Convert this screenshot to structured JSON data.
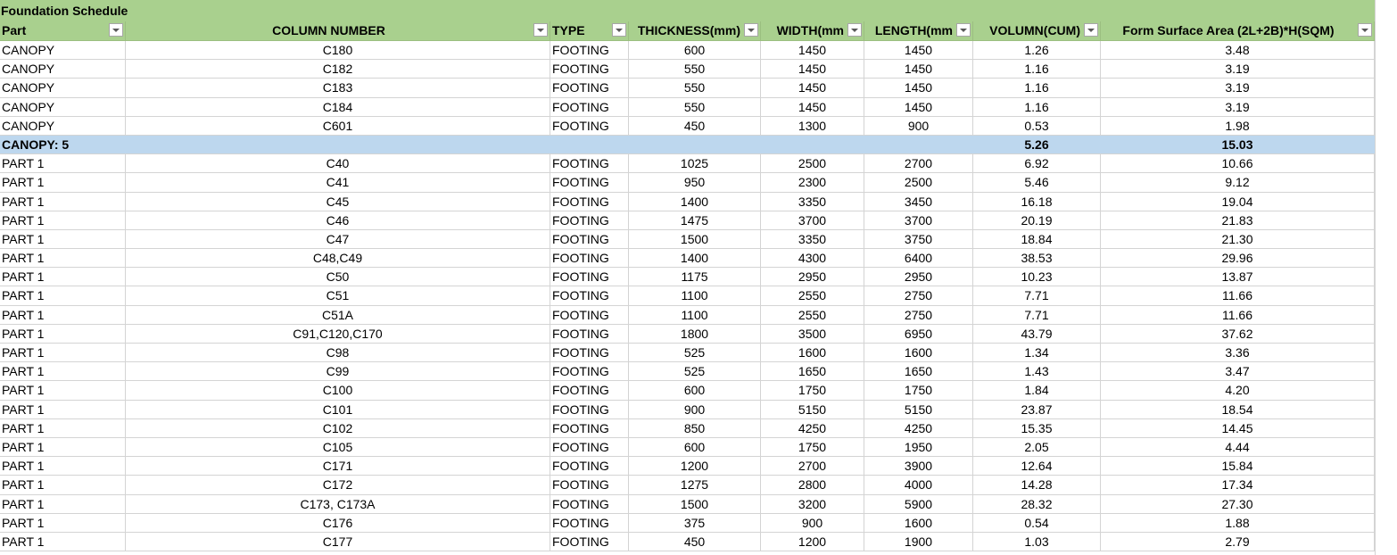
{
  "title": "Foundation Schedule",
  "headers": {
    "part": "Part",
    "column": "COLUMN NUMBER",
    "type": "TYPE",
    "thickness": "THICKNESS(mm)",
    "width": "WIDTH(mm",
    "length": "LENGTH(mm",
    "volume": "VOLUMN(CUM)",
    "form": "Form Surface Area (2L+2B)*H(SQM)"
  },
  "rows": [
    {
      "part": "CANOPY",
      "column": "C180",
      "type": "FOOTING",
      "thickness": "600",
      "width": "1450",
      "length": "1450",
      "volume": "1.26",
      "form": "3.48"
    },
    {
      "part": "CANOPY",
      "column": "C182",
      "type": "FOOTING",
      "thickness": "550",
      "width": "1450",
      "length": "1450",
      "volume": "1.16",
      "form": "3.19"
    },
    {
      "part": "CANOPY",
      "column": "C183",
      "type": "FOOTING",
      "thickness": "550",
      "width": "1450",
      "length": "1450",
      "volume": "1.16",
      "form": "3.19"
    },
    {
      "part": "CANOPY",
      "column": "C184",
      "type": "FOOTING",
      "thickness": "550",
      "width": "1450",
      "length": "1450",
      "volume": "1.16",
      "form": "3.19"
    },
    {
      "part": "CANOPY",
      "column": "C601",
      "type": "FOOTING",
      "thickness": "450",
      "width": "1300",
      "length": "900",
      "volume": "0.53",
      "form": "1.98"
    },
    {
      "part": "CANOPY: 5",
      "column": "",
      "type": "",
      "thickness": "",
      "width": "",
      "length": "",
      "volume": "5.26",
      "form": "15.03",
      "subtotal": true
    },
    {
      "part": "PART 1",
      "column": "C40",
      "type": "FOOTING",
      "thickness": "1025",
      "width": "2500",
      "length": "2700",
      "volume": "6.92",
      "form": "10.66"
    },
    {
      "part": "PART 1",
      "column": "C41",
      "type": "FOOTING",
      "thickness": "950",
      "width": "2300",
      "length": "2500",
      "volume": "5.46",
      "form": "9.12"
    },
    {
      "part": "PART 1",
      "column": "C45",
      "type": "FOOTING",
      "thickness": "1400",
      "width": "3350",
      "length": "3450",
      "volume": "16.18",
      "form": "19.04"
    },
    {
      "part": "PART 1",
      "column": "C46",
      "type": "FOOTING",
      "thickness": "1475",
      "width": "3700",
      "length": "3700",
      "volume": "20.19",
      "form": "21.83"
    },
    {
      "part": "PART 1",
      "column": "C47",
      "type": "FOOTING",
      "thickness": "1500",
      "width": "3350",
      "length": "3750",
      "volume": "18.84",
      "form": "21.30"
    },
    {
      "part": "PART 1",
      "column": "C48,C49",
      "type": "FOOTING",
      "thickness": "1400",
      "width": "4300",
      "length": "6400",
      "volume": "38.53",
      "form": "29.96"
    },
    {
      "part": "PART 1",
      "column": "C50",
      "type": "FOOTING",
      "thickness": "1175",
      "width": "2950",
      "length": "2950",
      "volume": "10.23",
      "form": "13.87"
    },
    {
      "part": "PART 1",
      "column": "C51",
      "type": "FOOTING",
      "thickness": "1100",
      "width": "2550",
      "length": "2750",
      "volume": "7.71",
      "form": "11.66"
    },
    {
      "part": "PART 1",
      "column": "C51A",
      "type": "FOOTING",
      "thickness": "1100",
      "width": "2550",
      "length": "2750",
      "volume": "7.71",
      "form": "11.66"
    },
    {
      "part": "PART 1",
      "column": "C91,C120,C170",
      "type": "FOOTING",
      "thickness": "1800",
      "width": "3500",
      "length": "6950",
      "volume": "43.79",
      "form": "37.62"
    },
    {
      "part": "PART 1",
      "column": "C98",
      "type": "FOOTING",
      "thickness": "525",
      "width": "1600",
      "length": "1600",
      "volume": "1.34",
      "form": "3.36"
    },
    {
      "part": "PART 1",
      "column": "C99",
      "type": "FOOTING",
      "thickness": "525",
      "width": "1650",
      "length": "1650",
      "volume": "1.43",
      "form": "3.47"
    },
    {
      "part": "PART 1",
      "column": "C100",
      "type": "FOOTING",
      "thickness": "600",
      "width": "1750",
      "length": "1750",
      "volume": "1.84",
      "form": "4.20"
    },
    {
      "part": "PART 1",
      "column": "C101",
      "type": "FOOTING",
      "thickness": "900",
      "width": "5150",
      "length": "5150",
      "volume": "23.87",
      "form": "18.54"
    },
    {
      "part": "PART 1",
      "column": "C102",
      "type": "FOOTING",
      "thickness": "850",
      "width": "4250",
      "length": "4250",
      "volume": "15.35",
      "form": "14.45"
    },
    {
      "part": "PART 1",
      "column": "C105",
      "type": "FOOTING",
      "thickness": "600",
      "width": "1750",
      "length": "1950",
      "volume": "2.05",
      "form": "4.44"
    },
    {
      "part": "PART 1",
      "column": "C171",
      "type": "FOOTING",
      "thickness": "1200",
      "width": "2700",
      "length": "3900",
      "volume": "12.64",
      "form": "15.84"
    },
    {
      "part": "PART 1",
      "column": "C172",
      "type": "FOOTING",
      "thickness": "1275",
      "width": "2800",
      "length": "4000",
      "volume": "14.28",
      "form": "17.34"
    },
    {
      "part": "PART 1",
      "column": "C173, C173A",
      "type": "FOOTING",
      "thickness": "1500",
      "width": "3200",
      "length": "5900",
      "volume": "28.32",
      "form": "27.30"
    },
    {
      "part": "PART 1",
      "column": "C176",
      "type": "FOOTING",
      "thickness": "375",
      "width": "900",
      "length": "1600",
      "volume": "0.54",
      "form": "1.88"
    },
    {
      "part": "PART 1",
      "column": "C177",
      "type": "FOOTING",
      "thickness": "450",
      "width": "1200",
      "length": "1900",
      "volume": "1.03",
      "form": "2.79"
    }
  ],
  "colors": {
    "header_green": "#a9d08e",
    "subtotal_blue": "#bdd7ee",
    "gridline": "#d4d4d4"
  },
  "icons": {
    "filter": "filter-dropdown-icon"
  }
}
